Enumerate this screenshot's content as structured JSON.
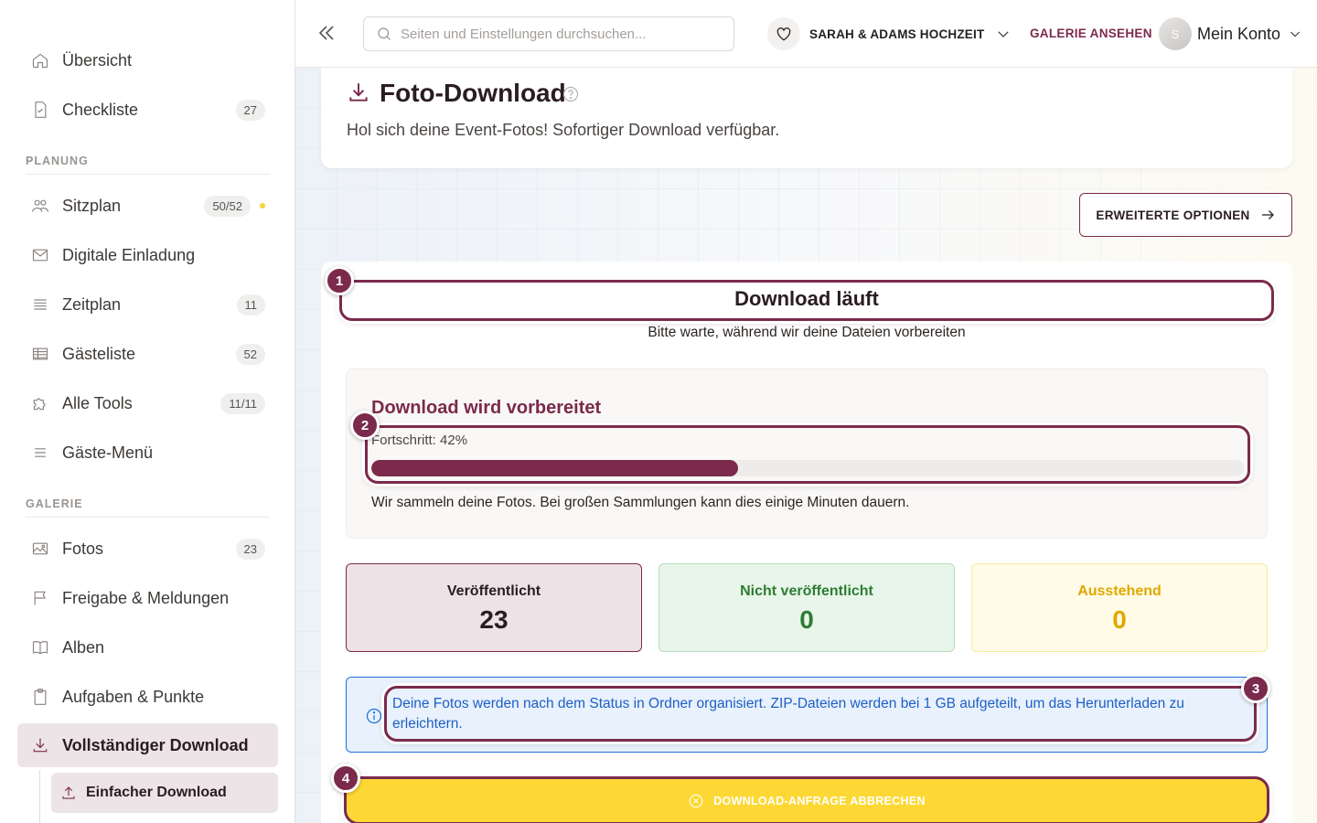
{
  "sidebar": {
    "items": [
      {
        "label": "Übersicht",
        "icon": "home-icon"
      },
      {
        "label": "Checkliste",
        "icon": "checklist-icon",
        "badge": "27"
      },
      {
        "label": "Sitzplan",
        "icon": "users-icon",
        "badge": "50/52"
      },
      {
        "label": "Digitale Einladung",
        "icon": "mail-icon"
      },
      {
        "label": "Zeitplan",
        "icon": "lines-icon",
        "badge": "11"
      },
      {
        "label": "Gästeliste",
        "icon": "table-icon",
        "badge": "52"
      },
      {
        "label": "Alle Tools",
        "icon": "puzzle-icon",
        "badge": "11/11"
      },
      {
        "label": "Gäste-Menü",
        "icon": "menu-icon"
      },
      {
        "label": "Fotos",
        "icon": "image-icon",
        "badge": "23"
      },
      {
        "label": "Freigabe & Meldungen",
        "icon": "flag-icon"
      },
      {
        "label": "Alben",
        "icon": "book-icon"
      },
      {
        "label": "Aufgaben & Punkte",
        "icon": "clipboard-icon"
      },
      {
        "label": "Vollständiger Download",
        "icon": "download-icon",
        "active": true
      }
    ],
    "sections": {
      "planung": "PLANUNG",
      "galerie": "GALERIE"
    },
    "sub_item": {
      "label": "Einfacher Download",
      "icon": "upload-icon"
    }
  },
  "topbar": {
    "search_placeholder": "Seiten und Einstellungen durchsuchen...",
    "event_name": "SARAH & ADAMS HOCHZEIT",
    "gallery_link": "GALERIE ANSEHEN",
    "avatar_initial": "S",
    "account_label": "Mein Konto"
  },
  "header": {
    "title": "Foto-Download",
    "subtitle": "Hol sich deine Event-Fotos! Sofortiger Download verfügbar."
  },
  "advanced_button": "ERWEITERTE OPTIONEN",
  "download": {
    "title": "Download läuft",
    "subtitle": "Bitte warte, während wir deine Dateien vorbereiten",
    "prep_title": "Download wird vorbereitet",
    "progress_label": "Fortschritt: 42%",
    "progress": 0.42,
    "note": "Wir sammeln deine Fotos. Bei großen Sammlungen kann dies einige Minuten dauern."
  },
  "stats": [
    {
      "label": "Veröffentlicht",
      "value": "23"
    },
    {
      "label": "Nicht veröffentlicht",
      "value": "0"
    },
    {
      "label": "Ausstehend",
      "value": "0"
    }
  ],
  "info_text": "Deine Fotos werden nach dem Status in Ordner organisiert. ZIP-Dateien werden bei 1 GB aufgeteilt, um das Herunterladen zu erleichtern.",
  "cancel_button": "DOWNLOAD-ANFRAGE ABBRECHEN",
  "markers": [
    "1",
    "2",
    "3",
    "4"
  ],
  "colors": {
    "accent": "#7b2a4c",
    "cancel": "#fdd835",
    "info": "#1e6fd9",
    "success": "#2e7d32",
    "pending": "#e0a800"
  }
}
